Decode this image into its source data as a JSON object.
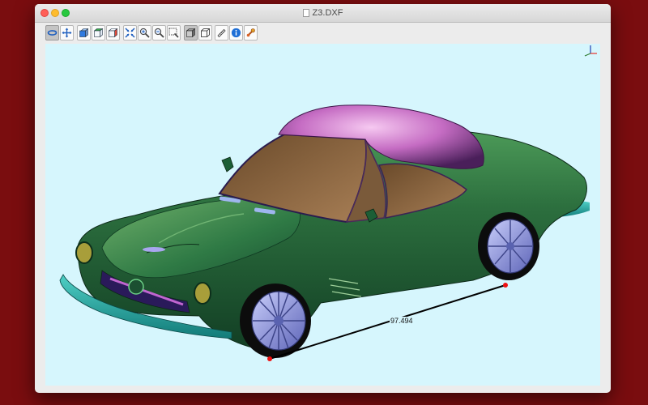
{
  "window": {
    "title": "Z3.DXF"
  },
  "toolbar": {
    "groups": [
      [
        "rotate-icon",
        "pan-icon"
      ],
      [
        "front-view-icon",
        "top-view-icon",
        "side-view-icon"
      ],
      [
        "fit-all-icon",
        "zoom-in-icon",
        "zoom-out-icon",
        "zoom-window-icon"
      ],
      [
        "shaded-mode-icon",
        "wireframe-mode-icon"
      ],
      [
        "measure-icon",
        "info-icon",
        "settings-icon"
      ]
    ]
  },
  "viewport": {
    "background": "#d6f6fd",
    "measurement": {
      "value": "97.494"
    },
    "axis_triad": {
      "x_color": "#e53935",
      "y_color": "#2e7d32",
      "z_color": "#1e40af"
    }
  },
  "colors": {
    "desktop": "#7a0d0f",
    "car_body": "#1f6b3d",
    "roof": "#c36fc0",
    "wheel": "#8a90d8",
    "measure_point": "#ee1111"
  }
}
